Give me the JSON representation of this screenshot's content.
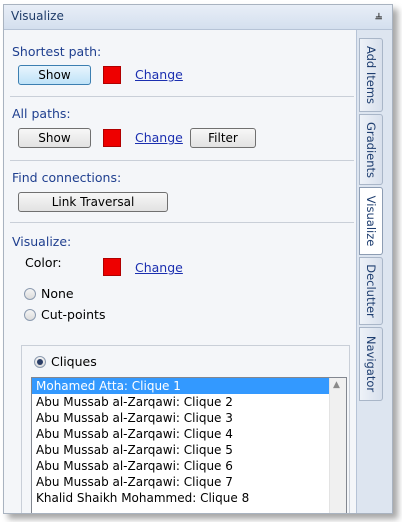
{
  "panel": {
    "title": "Visualize",
    "pin_glyph": "ᵖ"
  },
  "shortest_path": {
    "label": "Shortest path:",
    "show_button": "Show",
    "color": "#ee0000",
    "change_link": "Change"
  },
  "all_paths": {
    "label": "All paths:",
    "show_button": "Show",
    "color": "#ee0000",
    "change_link": "Change",
    "filter_button": "Filter"
  },
  "find_connections": {
    "label": "Find connections:",
    "link_traversal_button": "Link Traversal"
  },
  "visualize": {
    "label": "Visualize:",
    "color_label": "Color:",
    "color": "#ee0000",
    "change_link": "Change",
    "options": [
      {
        "label": "None",
        "checked": false
      },
      {
        "label": "Cut-points",
        "checked": false
      },
      {
        "label": "Cliques",
        "checked": true
      }
    ],
    "cliques_list": [
      "Mohamed Atta: Clique 1",
      "Abu Mussab al-Zarqawi: Clique 2",
      "Abu Mussab al-Zarqawi: Clique 3",
      "Abu Mussab al-Zarqawi: Clique 4",
      "Abu Mussab al-Zarqawi: Clique 5",
      "Abu Mussab al-Zarqawi: Clique 6",
      "Abu Mussab al-Zarqawi: Clique 7",
      "Khalid Shaikh Mohammed: Clique 8"
    ],
    "selected_index": 0,
    "scroll_up_glyph": "▲"
  },
  "side_tabs": [
    {
      "label": "Add Items",
      "active": false
    },
    {
      "label": "Gradients",
      "active": false
    },
    {
      "label": "Visualize",
      "active": true
    },
    {
      "label": "Declutter",
      "active": false
    },
    {
      "label": "Navigator",
      "active": false
    }
  ]
}
